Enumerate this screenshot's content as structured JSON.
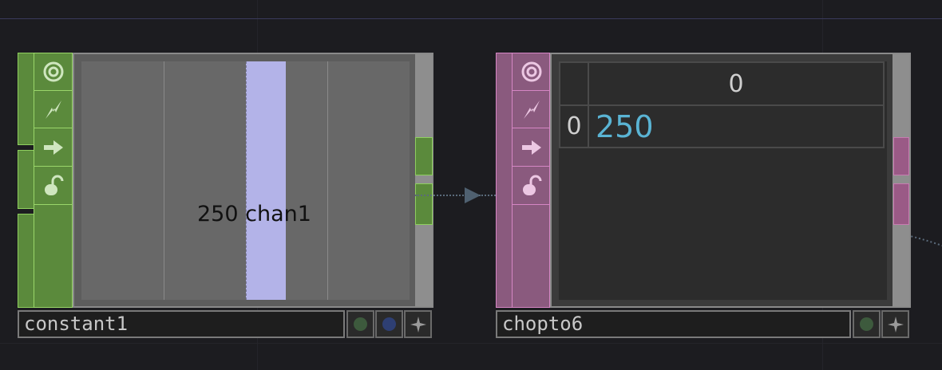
{
  "colors": {
    "canvas_bg": "#1c1c20",
    "chop_green": "#5b8a3c",
    "chop_green_border": "#8fcf5f",
    "dat_pink": "#8a5a7e",
    "dat_pink_border": "#d586c4",
    "channel_bar": "#b3b3e8",
    "table_value": "#5ab4d4"
  },
  "nodes": {
    "constant": {
      "name": "constant1",
      "channel_value": "250",
      "channel_name": "chan1",
      "side_buttons": [
        "viewer-toggle-icon",
        "cooking-bolt-icon",
        "export-arrow-icon",
        "lock-icon"
      ],
      "flags": [
        "bypass-flag-icon",
        "display-flag-icon",
        "pin-icon"
      ]
    },
    "chopto": {
      "name": "chopto6",
      "table": {
        "header": [
          "",
          "0"
        ],
        "rows": [
          [
            "0",
            "250"
          ]
        ]
      },
      "side_buttons": [
        "viewer-toggle-icon",
        "cooking-bolt-icon",
        "export-arrow-icon",
        "lock-icon"
      ],
      "flags": [
        "bypass-flag-icon",
        "pin-icon"
      ]
    }
  }
}
